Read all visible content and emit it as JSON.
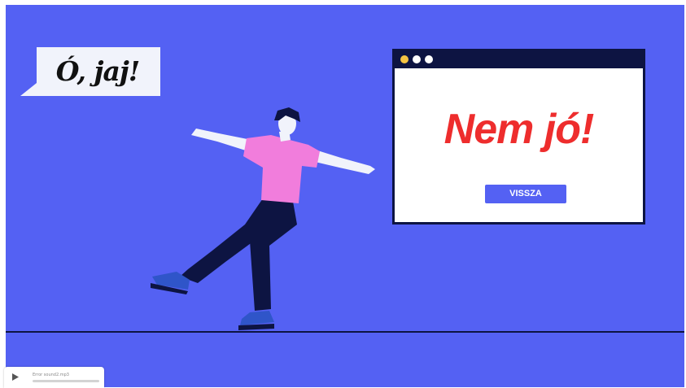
{
  "speech_bubble": {
    "text": "Ó, jaj!"
  },
  "browser_window": {
    "title": "Nem jó!",
    "back_button_label": "VISSZA"
  },
  "audio_player": {
    "file_name": "Error sound2.mp3",
    "progress": 0
  },
  "colors": {
    "background": "#5461f3",
    "accent_red": "#ee2d2d",
    "dark_navy": "#0d1442",
    "shirt_pink": "#f17ddc",
    "button_blue": "#5461f3",
    "dot_yellow": "#f5c443"
  },
  "icons": [
    "play-icon",
    "window-dots-icon"
  ]
}
